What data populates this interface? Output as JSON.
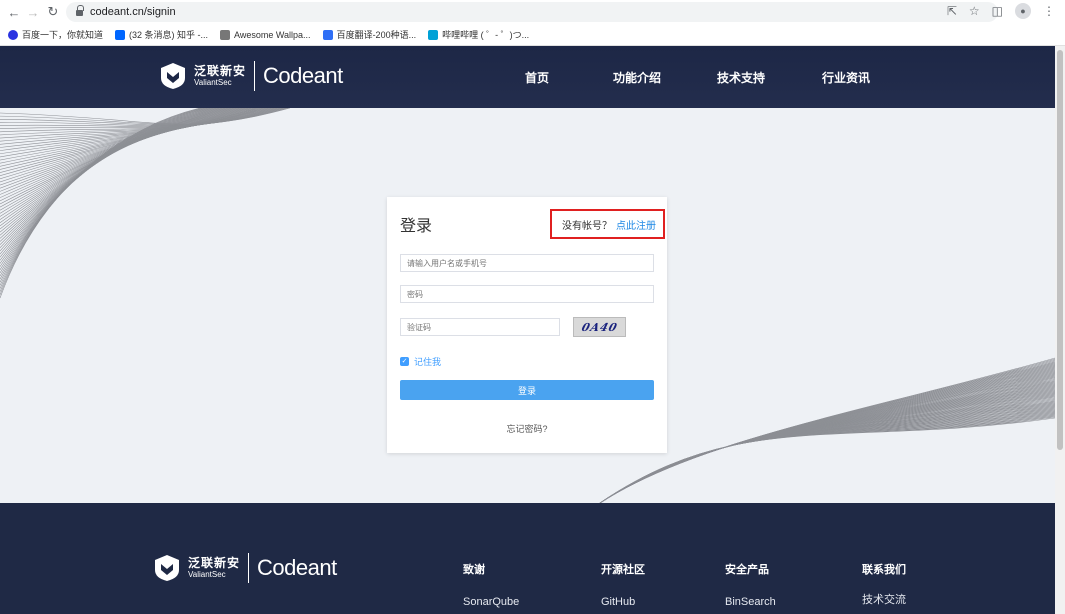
{
  "browser": {
    "url": "codeant.cn/signin",
    "bookmarks": [
      {
        "label": "百度一下，你就知道",
        "color": "#2932e1"
      },
      {
        "label": "(32 条消息) 知乎 -...",
        "color": "#0066ff"
      },
      {
        "label": "Awesome Wallpa...",
        "color": "#777777"
      },
      {
        "label": "百度翻译-200种语...",
        "color": "#2f6ff6"
      },
      {
        "label": "哔哩哔哩 ( ゜- ゜)つ...",
        "color": "#00a1d6"
      }
    ]
  },
  "nav": {
    "logo_cn": "泛联新安",
    "logo_sub": "ValiantSec",
    "logo_en": "Codeant",
    "items": [
      "首页",
      "功能介绍",
      "技术支持",
      "行业资讯"
    ]
  },
  "login": {
    "title": "登录",
    "no_account": "没有帐号？",
    "register_link": "点此注册",
    "username_placeholder": "请输入用户名或手机号",
    "password_placeholder": "密码",
    "captcha_placeholder": "验证码",
    "captcha_text": "0A40",
    "remember_me": "记住我",
    "login_button": "登录",
    "forgot_password": "忘记密码?"
  },
  "footer": {
    "logo_cn": "泛联新安",
    "logo_sub": "ValiantSec",
    "logo_en": "Codeant",
    "columns": [
      {
        "heading": "致谢",
        "item": "SonarQube"
      },
      {
        "heading": "开源社区",
        "item": "GitHub"
      },
      {
        "heading": "安全产品",
        "item": "BinSearch"
      },
      {
        "heading": "联系我们",
        "item": "技术交流"
      }
    ]
  },
  "colors": {
    "nav_bg": "#1d2746",
    "accent": "#409eff",
    "highlight_border": "#e02020"
  }
}
